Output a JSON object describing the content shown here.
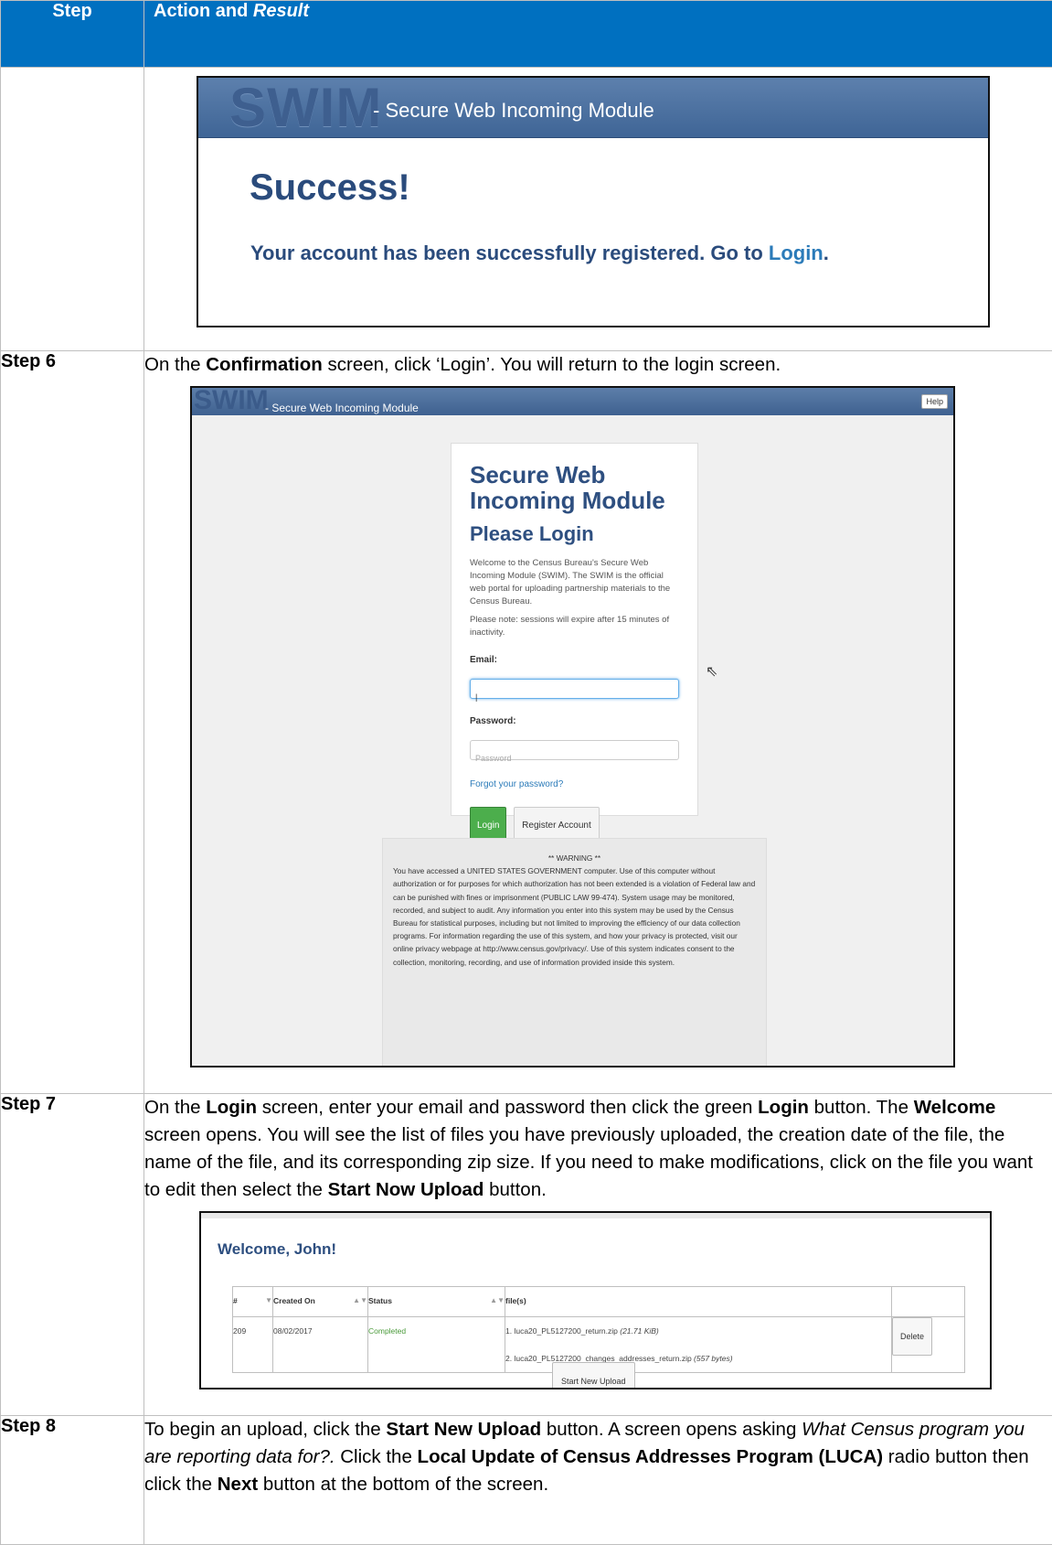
{
  "header": {
    "step": "Step",
    "action_prefix": "Action and ",
    "action_result": "Result"
  },
  "success_screen": {
    "logo": "SWIM",
    "tagline": "- Secure Web Incoming Module",
    "title": "Success!",
    "message": "Your account has been successfully registered. Go to ",
    "login_link": "Login",
    "period": "."
  },
  "step6": {
    "label": "Step 6",
    "t1": "On the ",
    "b1": "Confirmation",
    "t2": " screen, click ‘Login’. You will return to the login screen."
  },
  "login_screen": {
    "logo": "SWIM",
    "tagline": "- Secure Web Incoming Module",
    "help": "Help",
    "title": "Secure Web Incoming Module",
    "subtitle": "Please Login",
    "welcome": "Welcome to the Census Bureau's Secure Web Incoming Module (SWIM). The SWIM is the official web portal for uploading partnership materials to the Census Bureau.",
    "note": "Please note: sessions will expire after 15 minutes of inactivity.",
    "email_label": "Email:",
    "email_value": "|",
    "password_label": "Password:",
    "password_placeholder": "Password",
    "forgot": "Forgot your password?",
    "login_button": "Login",
    "register_button": "Register Account",
    "warning_title": "** WARNING **",
    "warning_text": "You have accessed a UNITED STATES GOVERNMENT computer. Use of this computer without authorization or for purposes for which authorization has not been extended is a violation of Federal law and can be punished with fines or imprisonment (PUBLIC LAW 99-474). System usage may be monitored, recorded, and subject to audit. Any information you enter into this system may be used by the Census Bureau for statistical purposes, including but not limited to improving the efficiency of our data collection programs. For information regarding the use of this system, and how your privacy is protected, visit our online privacy webpage at http://www.census.gov/privacy/. Use of this system indicates consent to the collection, monitoring, recording, and use of information provided inside this system."
  },
  "step7": {
    "label": "Step 7",
    "t1": "On the ",
    "b1": "Login",
    "t2": " screen, enter your email and password then click the green ",
    "b2": "Login",
    "t3": " button. The ",
    "b3": "Welcome",
    "t4": " screen opens. You will see the list of files you have previously uploaded, the creation date of the file, the name of the file, and its corresponding zip size. If you need to make modifications, click on the file you want to edit then select the ",
    "b4": "Start Now Upload",
    "t5": " button."
  },
  "welcome_screen": {
    "title": "Welcome, John!",
    "columns": [
      "#",
      "Created On",
      "Status",
      "file(s)"
    ],
    "row": {
      "id": "209",
      "created": "08/02/2017",
      "status": "Completed",
      "file1_name": "1.  luca20_PL5127200_return.zip ",
      "file1_size": "(21.71 KiB)",
      "file2_name": "2.  luca20_PL5127200_changes_addresses_return.zip ",
      "file2_size": "(557 bytes)",
      "delete": "Delete"
    },
    "start_button": "Start New Upload"
  },
  "step8": {
    "label": "Step 8",
    "t1": "To begin an upload, click the ",
    "b1": "Start New Upload",
    "t2": " button. A screen opens asking ",
    "i1": "What Census program you are reporting data for?.",
    "t3": " Click the ",
    "b2": "Local Update of Census Addresses Program (LUCA)",
    "t4": " radio button then click the ",
    "b3": "Next",
    "t5": " button at the bottom of the screen."
  }
}
